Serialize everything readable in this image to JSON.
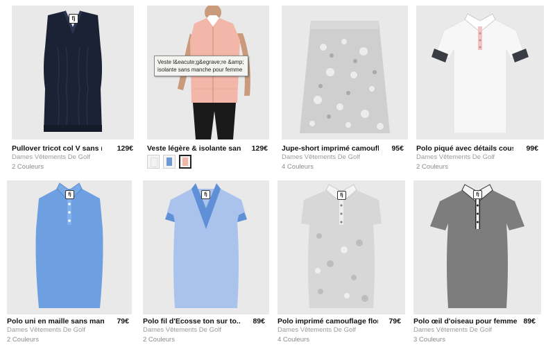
{
  "colors": {
    "tile_bg": "#e9e9e9",
    "text": "#111111",
    "muted": "#9a9a9a"
  },
  "tooltip": {
    "text": "Veste l&eacute;g&egrave;re &amp; isolante sans manche pour femme"
  },
  "products": [
    {
      "name": "Pullover tricot col V sans m...",
      "price": "129€",
      "category": "Dames Vêtements De Golf",
      "colors": "2 Couleurs",
      "garment": "navy-vest",
      "garment_color": "#1b2235"
    },
    {
      "name": "Veste légère & isolante sans...",
      "price": "129€",
      "category": "Dames Vêtements De Golf",
      "colors": "",
      "garment": "pink-vest",
      "garment_color": "#f2b7a8",
      "swatches": [
        {
          "color": "#f3f3f3"
        },
        {
          "color": "#6f97d3"
        },
        {
          "color": "#f2b7a8",
          "selected": true
        }
      ]
    },
    {
      "name": "Jupe-short imprimé camouflag...",
      "price": "95€",
      "category": "Dames Vêtements De Golf",
      "colors": "4 Couleurs",
      "garment": "grey-skirt",
      "garment_color": "#c9c9c9"
    },
    {
      "name": "Polo piqué avec détails cous...",
      "price": "99€",
      "category": "Dames Vêtements De Golf",
      "colors": "2 Couleurs",
      "garment": "white-polo",
      "garment_color": "#f7f7f7"
    },
    {
      "name": "Polo uni en maille sans manc...",
      "price": "79€",
      "category": "Dames Vêtements De Golf",
      "colors": "2 Couleurs",
      "garment": "blue-polo",
      "garment_color": "#6e9fe0"
    },
    {
      "name": "Polo fil d'Ecosse ton sur to...",
      "price": "89€",
      "category": "Dames Vêtements De Golf",
      "colors": "2 Couleurs",
      "garment": "lightblue-polo",
      "garment_color": "#a9c3ec"
    },
    {
      "name": "Polo imprimé camouflage flor...",
      "price": "79€",
      "category": "Dames Vêtements De Golf",
      "colors": "4 Couleurs",
      "garment": "camo-polo",
      "garment_color": "#d7d7d7"
    },
    {
      "name": "Polo œil d'oiseau pour femme",
      "price": "89€",
      "category": "Dames Vêtements De Golf",
      "colors": "3 Couleurs",
      "garment": "grey-polo",
      "garment_color": "#7d7d7d"
    }
  ]
}
